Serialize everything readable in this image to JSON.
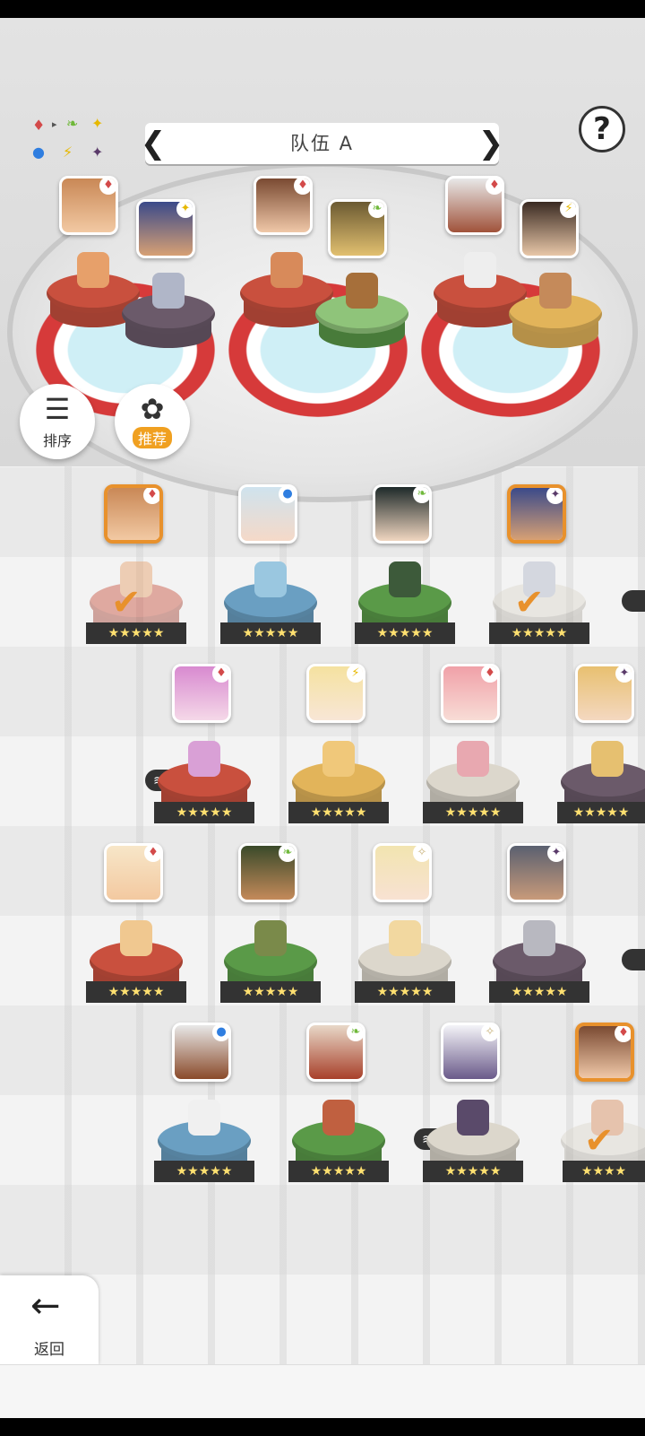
{
  "header": {
    "team_title": "队伍 A",
    "prev_icon": "chevron-left-icon",
    "next_icon": "chevron-right-icon",
    "help_label": "?"
  },
  "side_buttons": {
    "sort_label": "排序",
    "recommend_label": "推荐"
  },
  "back_button": {
    "label": "返回"
  },
  "element_legend": [
    "♦",
    "⯈",
    "🍃",
    "✦",
    "●",
    "⚡",
    "✦"
  ],
  "team_slots": [
    {
      "element": "fire",
      "leader": true
    },
    {
      "element": "dark"
    },
    {
      "element": "fire"
    },
    {
      "element": "wood"
    },
    {
      "element": "fire"
    },
    {
      "element": "light"
    }
  ],
  "roster_rows": [
    [
      {
        "element": "fire",
        "color": "fire",
        "stars": "★★★★★",
        "selected": true
      },
      {
        "element": "water",
        "color": "water",
        "stars": "★★★★★"
      },
      {
        "element": "wood",
        "color": "wood",
        "stars": "★★★★★"
      },
      {
        "element": "dark",
        "color": "white",
        "stars": "★★★★★",
        "selected": true
      }
    ],
    [
      {
        "element": "fire",
        "color": "fire",
        "stars": "★★★★★",
        "dup": "1"
      },
      {
        "element": "light",
        "color": "light",
        "stars": "★★★★★"
      },
      {
        "element": "fire",
        "color": "white",
        "stars": "★★★★★"
      },
      {
        "element": "dark",
        "color": "dark",
        "stars": "★★★★★"
      }
    ],
    [
      {
        "element": "fire",
        "color": "fire",
        "stars": "★★★★★"
      },
      {
        "element": "wood",
        "color": "wood",
        "stars": "★★★★★"
      },
      {
        "element": "neutral",
        "color": "white",
        "stars": "★★★★★"
      },
      {
        "element": "dark",
        "color": "dark",
        "stars": "★★★★★"
      }
    ],
    [
      {
        "element": "water",
        "color": "water",
        "stars": "★★★★★"
      },
      {
        "element": "wood",
        "color": "wood",
        "stars": "★★★★★"
      },
      {
        "element": "neutral",
        "color": "white",
        "stars": "★★★★★",
        "dup": "1"
      },
      {
        "element": "fire",
        "color": "fire",
        "stars": "★★★★",
        "selected": true
      }
    ]
  ],
  "dup_badge_label": "1",
  "colors": {
    "accent": "#e8912c",
    "recommend": "#f0a020"
  }
}
